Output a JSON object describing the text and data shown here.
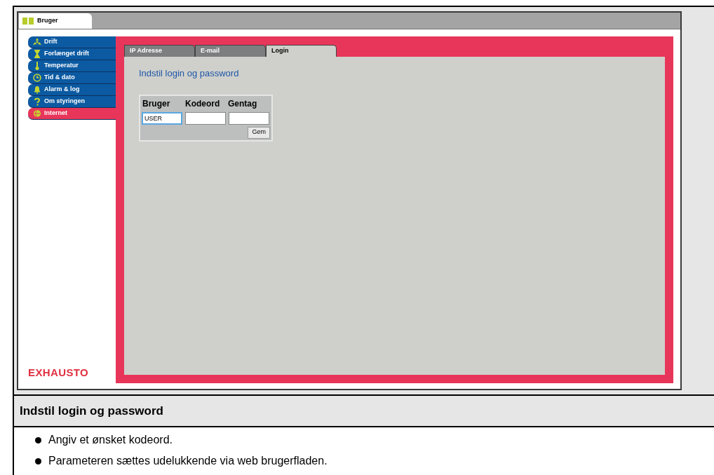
{
  "app_tab": {
    "label": "Bruger",
    "selected": true
  },
  "menu": [
    {
      "label": "Drift",
      "selected": false
    },
    {
      "label": "Forlænget drift",
      "selected": false
    },
    {
      "label": "Temperatur",
      "selected": false
    },
    {
      "label": "Tid & dato",
      "selected": false
    },
    {
      "label": "Alarm & log",
      "selected": false
    },
    {
      "label": "Om styringen",
      "selected": false
    },
    {
      "label": "Internet",
      "selected": true
    }
  ],
  "logo": "EXHAUSTO",
  "tabs": [
    {
      "label": "IP Adresse",
      "selected": false
    },
    {
      "label": "E-mail",
      "selected": false
    },
    {
      "label": "Login",
      "selected": true
    }
  ],
  "panel_title": "Indstil login og password",
  "form": {
    "columns": [
      "Bruger",
      "Kodeord",
      "Gentag"
    ],
    "fields": [
      {
        "value": "USER",
        "focused": true
      },
      {
        "focused": false
      },
      {
        "focused": false
      }
    ],
    "button": "Gem"
  },
  "caption": {
    "heading": "Indstil login og password",
    "bullets": [
      "Angiv et ønsket kodeord.",
      "Parameteren sættes udelukkende via web brugerfladen."
    ]
  }
}
